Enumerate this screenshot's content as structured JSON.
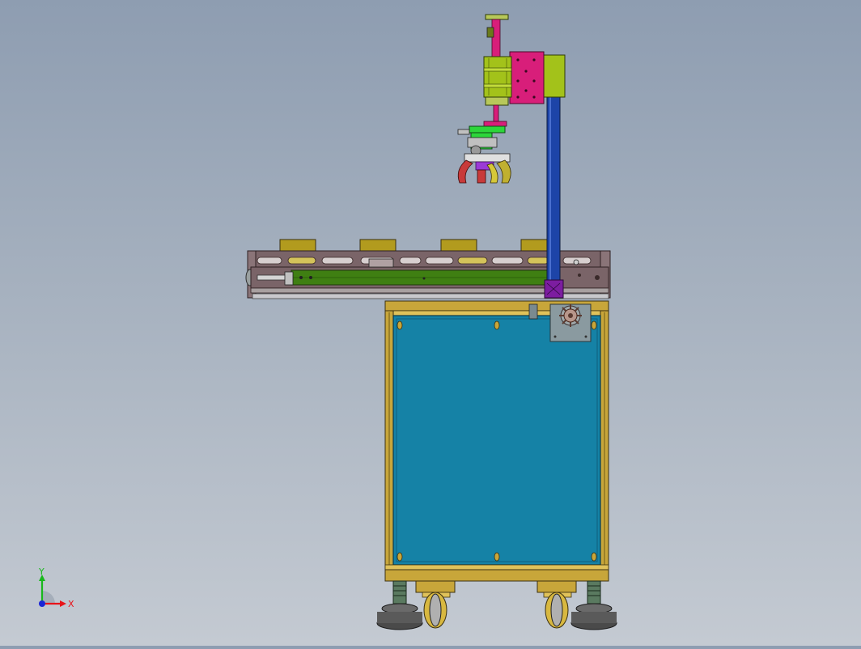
{
  "viewport": {
    "background_top": "#8e9db1",
    "background_bottom": "#c4cad2"
  },
  "triad": {
    "x_label": "X",
    "y_label": "Y",
    "x_color": "#e8141a",
    "y_color": "#18b81c",
    "z_color": "#1a25d6"
  },
  "colors": {
    "cabinet_panel": "#1582a6",
    "cabinet_frame": "#c8a63a",
    "conveyor_rail": "#7a6468",
    "conveyor_belt": "#3f7f12",
    "pallet": "#b29b1e",
    "column": "#1d44a8",
    "carriage": "#d81e7a",
    "cylinder": "#a3c21a",
    "gripper_body": "#2cd63a",
    "gripper_jaw": "#c83a3a"
  },
  "parts": [
    "z-axis-cylinder",
    "linear-module",
    "vertical-column",
    "gripper",
    "belt-conveyor",
    "pallet",
    "motor-sprocket",
    "electrical-cabinet",
    "caster-wheel",
    "leveling-foot"
  ]
}
